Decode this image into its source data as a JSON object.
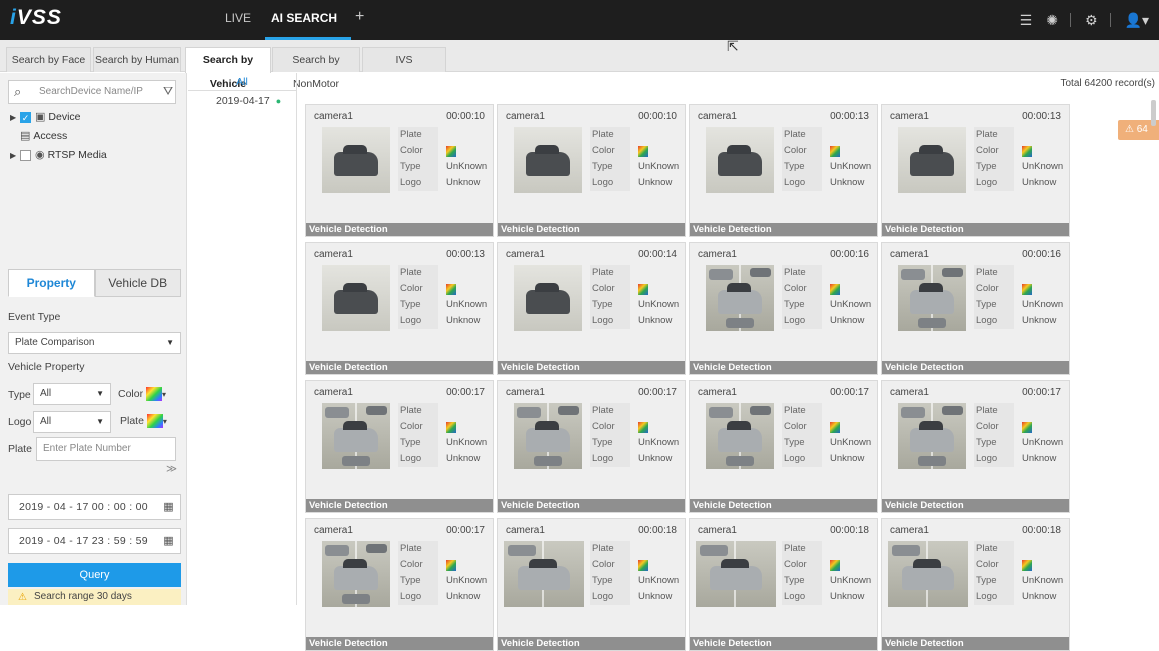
{
  "app": {
    "logo": "iVSS",
    "nav": [
      "LIVE",
      "AI SEARCH"
    ],
    "active_nav": "AI SEARCH",
    "add_tab": "+",
    "icons": [
      "list-icon",
      "globe-icon",
      "gear-icon",
      "user-icon"
    ]
  },
  "tabs": [
    {
      "label": "Search by Face"
    },
    {
      "label": "Search by Human"
    },
    {
      "label": "Search by Vehicle"
    },
    {
      "label": "Search by NonMotor"
    },
    {
      "label": "IVS"
    }
  ],
  "active_tab": "Search by Vehicle",
  "sidebar": {
    "search_placeholder": "SearchDevice Name/IP",
    "tree": {
      "device": "Device",
      "access": "Access",
      "rtsp": "RTSP Media"
    },
    "prop_tabs": [
      "Property",
      "Vehicle DB"
    ],
    "event_type_label": "Event Type",
    "event_type_value": "Plate Comparison",
    "vehicle_property_label": "Vehicle Property",
    "type_label": "Type",
    "type_value": "All",
    "color_label": "Color",
    "logo_label": "Logo",
    "logo_value": "All",
    "plate_color_label": "Plate",
    "plate_label": "Plate",
    "plate_placeholder": "Enter Plate Number",
    "start_time": "2019 - 04 - 17  00 : 00 : 00",
    "end_time": "2019 - 04 - 17  23 : 59 : 59",
    "query_label": "Query",
    "warning": "Search range 30 days"
  },
  "dates": {
    "all": "All",
    "items": [
      "2019-04-17"
    ]
  },
  "results": {
    "total": "Total 64200 record(s)",
    "alert_count": "64",
    "labels": {
      "plate": "Plate",
      "color": "Color",
      "type": "Type",
      "logo": "Logo"
    },
    "footer": "Vehicle Detection",
    "cards": [
      {
        "camera": "camera1",
        "time": "00:00:10",
        "type": "UnKnown",
        "logo": "Unknow"
      },
      {
        "camera": "camera1",
        "time": "00:00:10",
        "type": "UnKnown",
        "logo": "Unknow"
      },
      {
        "camera": "camera1",
        "time": "00:00:13",
        "type": "UnKnown",
        "logo": "Unknow"
      },
      {
        "camera": "camera1",
        "time": "00:00:13",
        "type": "UnKnown",
        "logo": "Unknow"
      },
      {
        "camera": "camera1",
        "time": "00:00:13",
        "type": "UnKnown",
        "logo": "Unknow"
      },
      {
        "camera": "camera1",
        "time": "00:00:14",
        "type": "UnKnown",
        "logo": "Unknow"
      },
      {
        "camera": "camera1",
        "time": "00:00:16",
        "type": "UnKnown",
        "logo": "Unknow"
      },
      {
        "camera": "camera1",
        "time": "00:00:16",
        "type": "UnKnown",
        "logo": "Unknow"
      },
      {
        "camera": "camera1",
        "time": "00:00:17",
        "type": "UnKnown",
        "logo": "Unknow"
      },
      {
        "camera": "camera1",
        "time": "00:00:17",
        "type": "UnKnown",
        "logo": "Unknow"
      },
      {
        "camera": "camera1",
        "time": "00:00:17",
        "type": "UnKnown",
        "logo": "Unknow"
      },
      {
        "camera": "camera1",
        "time": "00:00:17",
        "type": "UnKnown",
        "logo": "Unknow"
      },
      {
        "camera": "camera1",
        "time": "00:00:17",
        "type": "UnKnown",
        "logo": "Unknow"
      },
      {
        "camera": "camera1",
        "time": "00:00:18",
        "type": "UnKnown",
        "logo": "Unknow"
      },
      {
        "camera": "camera1",
        "time": "00:00:18",
        "type": "UnKnown",
        "logo": "Unknow"
      },
      {
        "camera": "camera1",
        "time": "00:00:18",
        "type": "UnKnown",
        "logo": "Unknow"
      }
    ]
  }
}
